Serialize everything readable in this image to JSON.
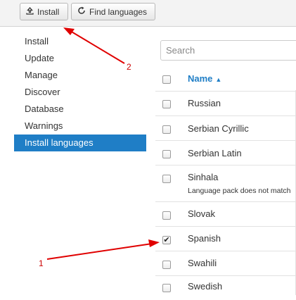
{
  "toolbar": {
    "install_label": "Install",
    "find_languages_label": "Find languages"
  },
  "sidebar": {
    "items": [
      {
        "label": "Install"
      },
      {
        "label": "Update"
      },
      {
        "label": "Manage"
      },
      {
        "label": "Discover"
      },
      {
        "label": "Database"
      },
      {
        "label": "Warnings"
      },
      {
        "label": "Install languages",
        "active": true
      }
    ]
  },
  "search": {
    "placeholder": "Search"
  },
  "table": {
    "header": {
      "name": "Name"
    },
    "rows": [
      {
        "name": "Russian",
        "checked": false
      },
      {
        "name": "Serbian Cyrillic",
        "checked": false
      },
      {
        "name": "Serbian Latin",
        "checked": false
      },
      {
        "name": "Sinhala",
        "note": "Language pack does not match",
        "checked": false
      },
      {
        "name": "Slovak",
        "checked": false
      },
      {
        "name": "Spanish",
        "checked": true
      },
      {
        "name": "Swahili",
        "checked": false
      },
      {
        "name": "Swedish",
        "checked": false
      }
    ]
  },
  "annotations": {
    "callout_1": "1",
    "callout_2": "2",
    "color": "#e00000"
  },
  "colors": {
    "accent": "#1f7ec6",
    "toolbar_bg": "#f3f3f3"
  }
}
